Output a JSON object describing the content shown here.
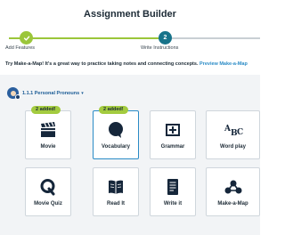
{
  "header": {
    "title": "Assignment Builder"
  },
  "steps": [
    {
      "label": "Add Features",
      "state": "done",
      "icon": "check-icon"
    },
    {
      "label": "Write Instructions",
      "number": "2",
      "state": "current"
    }
  ],
  "intro": {
    "text": "Try Make-a-Map! It's a great way to practice taking notes and connecting concepts.",
    "link": "Preview Make-a-Map"
  },
  "topic": {
    "label": "1.1.1 Personal Pronouns",
    "icon": "caret-down-icon"
  },
  "added_badge": "2 added!",
  "features": [
    {
      "label": "Movie",
      "icon": "clapperboard-icon",
      "added": true
    },
    {
      "label": "Vocabulary",
      "icon": "speech-bubble-icon",
      "added": true,
      "selected": true
    },
    {
      "label": "Grammar",
      "icon": "grammar-icon"
    },
    {
      "label": "Word play",
      "icon": "abc-icon"
    },
    {
      "label": "Movie Quiz",
      "icon": "quiz-q-icon"
    },
    {
      "label": "Read It",
      "icon": "book-icon"
    },
    {
      "label": "Write it",
      "icon": "document-icon"
    },
    {
      "label": "Make-a-Map",
      "icon": "concept-map-icon"
    }
  ],
  "colors": {
    "accent_green": "#9bc63a",
    "step_current": "#17738a",
    "link_blue": "#2a8bc6",
    "icon_navy": "#15263a"
  }
}
